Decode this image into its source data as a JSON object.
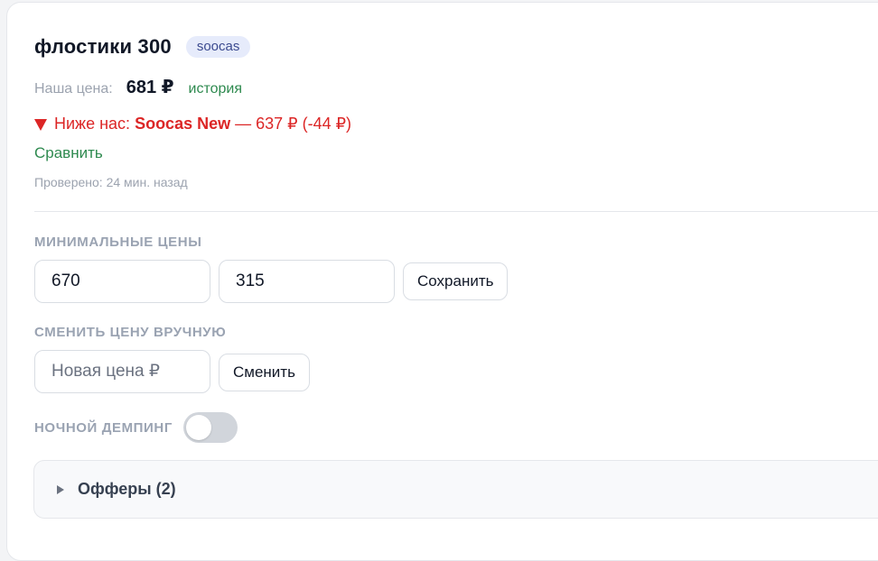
{
  "product": {
    "title": "флостики 300",
    "badge": "soocas"
  },
  "price": {
    "label": "Наша цена:",
    "value": "681 ₽",
    "history_link": "история"
  },
  "alert": {
    "prefix": "Ниже нас:",
    "competitor": "Soocas New",
    "details": "— 637 ₽ (-44 ₽)",
    "icon": "triangle-down-icon",
    "color": "#dc2626"
  },
  "compare_link": "Сравнить",
  "checked_text": "Проверено: 24 мин. назад",
  "min_prices": {
    "label": "МИНИМАЛЬНЫЕ ЦЕНЫ",
    "value_1": "670",
    "value_2": "315",
    "save_label": "Сохранить"
  },
  "manual_price": {
    "label": "СМЕНИТЬ ЦЕНУ ВРУЧНУЮ",
    "placeholder": "Новая цена ₽",
    "value": "",
    "change_label": "Сменить"
  },
  "night_dumping": {
    "label": "НОЧНОЙ ДЕМПИНГ",
    "enabled": false
  },
  "offers": {
    "label": "Офферы (2)",
    "icon": "caret-right-icon"
  },
  "colors": {
    "accent_green": "#2e8a4f",
    "alert_red": "#dc2626",
    "badge_bg": "#e6ebfb"
  }
}
